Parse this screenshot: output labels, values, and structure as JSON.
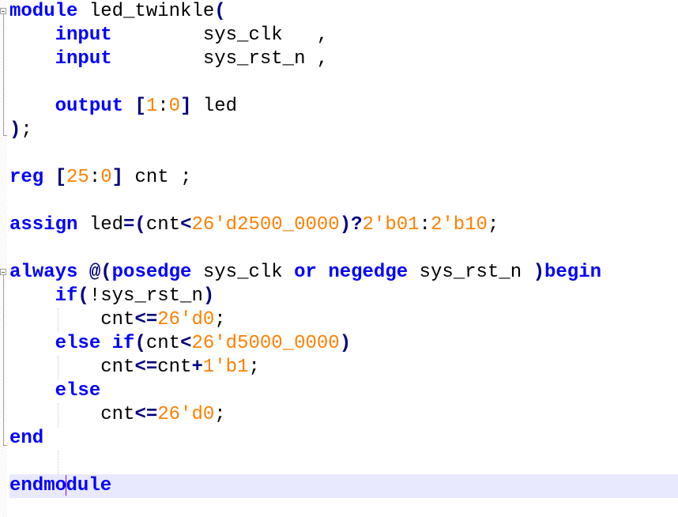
{
  "editor": {
    "language": "verilog",
    "current_line": 21,
    "lines": [
      {
        "n": 1,
        "tokens": [
          [
            "kw",
            "module"
          ],
          [
            "id",
            " led_twinkle"
          ],
          [
            "op",
            "("
          ]
        ]
      },
      {
        "n": 2,
        "tokens": [
          [
            "id",
            "    "
          ],
          [
            "kw",
            "input"
          ],
          [
            "id",
            "        sys_clk   ,"
          ]
        ]
      },
      {
        "n": 3,
        "tokens": [
          [
            "id",
            "    "
          ],
          [
            "kw",
            "input"
          ],
          [
            "id",
            "        sys_rst_n ,"
          ]
        ]
      },
      {
        "n": 4,
        "tokens": []
      },
      {
        "n": 5,
        "tokens": [
          [
            "id",
            "    "
          ],
          [
            "kw",
            "output"
          ],
          [
            "id",
            " "
          ],
          [
            "op",
            "["
          ],
          [
            "num",
            "1"
          ],
          [
            "id",
            ":"
          ],
          [
            "num",
            "0"
          ],
          [
            "op",
            "]"
          ],
          [
            "id",
            " led"
          ]
        ]
      },
      {
        "n": 6,
        "tokens": [
          [
            "op",
            ")"
          ],
          [
            "id",
            ";"
          ]
        ]
      },
      {
        "n": 7,
        "tokens": []
      },
      {
        "n": 8,
        "tokens": [
          [
            "kw",
            "reg"
          ],
          [
            "id",
            " "
          ],
          [
            "op",
            "["
          ],
          [
            "num",
            "25"
          ],
          [
            "id",
            ":"
          ],
          [
            "num",
            "0"
          ],
          [
            "op",
            "]"
          ],
          [
            "id",
            " cnt ;"
          ]
        ]
      },
      {
        "n": 9,
        "tokens": []
      },
      {
        "n": 10,
        "tokens": [
          [
            "kw",
            "assign"
          ],
          [
            "id",
            " led"
          ],
          [
            "op",
            "=("
          ],
          [
            "id",
            "cnt"
          ],
          [
            "op",
            "<"
          ],
          [
            "num",
            "26'd2500_0000"
          ],
          [
            "op",
            ")?"
          ],
          [
            "num",
            "2'b01"
          ],
          [
            "id",
            ":"
          ],
          [
            "num",
            "2'b10"
          ],
          [
            "id",
            ";"
          ]
        ]
      },
      {
        "n": 11,
        "tokens": []
      },
      {
        "n": 12,
        "tokens": [
          [
            "kw",
            "always"
          ],
          [
            "id",
            " "
          ],
          [
            "op",
            "@("
          ],
          [
            "kw",
            "posedge"
          ],
          [
            "id",
            " sys_clk "
          ],
          [
            "kw",
            "or"
          ],
          [
            "id",
            " "
          ],
          [
            "kw",
            "negedge"
          ],
          [
            "id",
            " sys_rst_n "
          ],
          [
            "op",
            ")"
          ],
          [
            "kw",
            "begin"
          ]
        ]
      },
      {
        "n": 13,
        "tokens": [
          [
            "id",
            "    "
          ],
          [
            "kw",
            "if"
          ],
          [
            "op",
            "("
          ],
          [
            "id",
            "!sys_rst_n"
          ],
          [
            "op",
            ")"
          ]
        ]
      },
      {
        "n": 14,
        "tokens": [
          [
            "id",
            "        cnt"
          ],
          [
            "op",
            "<="
          ],
          [
            "num",
            "26'd0"
          ],
          [
            "id",
            ";"
          ]
        ]
      },
      {
        "n": 15,
        "tokens": [
          [
            "id",
            "    "
          ],
          [
            "kw",
            "else"
          ],
          [
            "id",
            " "
          ],
          [
            "kw",
            "if"
          ],
          [
            "op",
            "("
          ],
          [
            "id",
            "cnt"
          ],
          [
            "op",
            "<"
          ],
          [
            "num",
            "26'd5000_0000"
          ],
          [
            "op",
            ")"
          ]
        ]
      },
      {
        "n": 16,
        "tokens": [
          [
            "id",
            "        cnt"
          ],
          [
            "op",
            "<="
          ],
          [
            "id",
            "cnt"
          ],
          [
            "op",
            "+"
          ],
          [
            "num",
            "1'b1"
          ],
          [
            "id",
            ";"
          ]
        ]
      },
      {
        "n": 17,
        "tokens": [
          [
            "id",
            "    "
          ],
          [
            "kw",
            "else"
          ]
        ]
      },
      {
        "n": 18,
        "tokens": [
          [
            "id",
            "        cnt"
          ],
          [
            "op",
            "<="
          ],
          [
            "num",
            "26'd0"
          ],
          [
            "id",
            ";"
          ]
        ]
      },
      {
        "n": 19,
        "tokens": [
          [
            "kw",
            "end"
          ]
        ]
      },
      {
        "n": 20,
        "tokens": []
      },
      {
        "n": 21,
        "tokens": [
          [
            "kw",
            "endmo"
          ],
          [
            "caret",
            ""
          ],
          [
            "kw",
            "dule"
          ]
        ]
      }
    ]
  },
  "colors": {
    "keyword": "#0000ff",
    "operator": "#000080",
    "number": "#ff8000",
    "identifier": "#000000",
    "current_line_bg": "#e8e8ff",
    "caret": "#8000ff"
  }
}
